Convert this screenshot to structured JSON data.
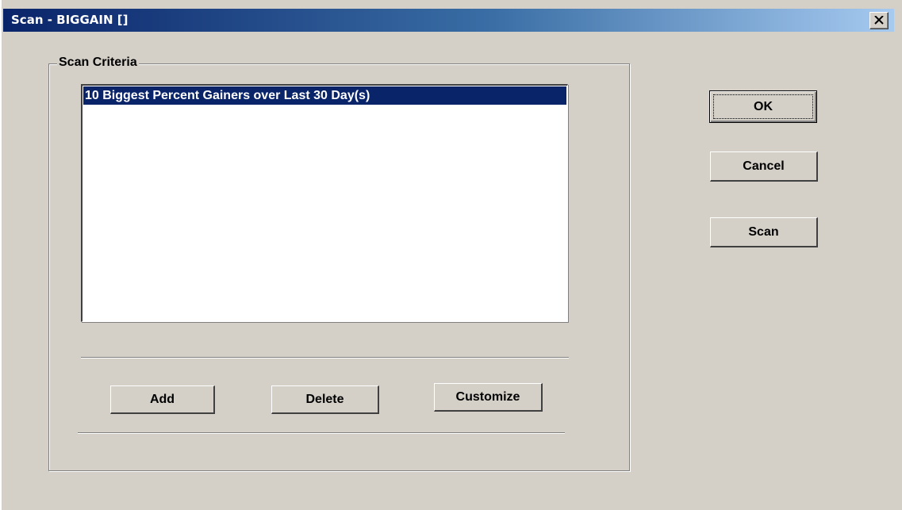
{
  "window": {
    "title": "Scan - BIGGAIN []"
  },
  "scan_criteria": {
    "label": "Scan Criteria",
    "items": [
      {
        "label": "10 Biggest Percent Gainers over Last 30 Day(s)",
        "selected": true
      }
    ]
  },
  "buttons": {
    "ok": "OK",
    "cancel": "Cancel",
    "scan": "Scan",
    "add": "Add",
    "delete": "Delete",
    "customize": "Customize"
  },
  "colors": {
    "face": "#d4d0c8",
    "selection": "#0a246a",
    "title_start": "#0a246a",
    "title_end": "#a6caf0"
  }
}
